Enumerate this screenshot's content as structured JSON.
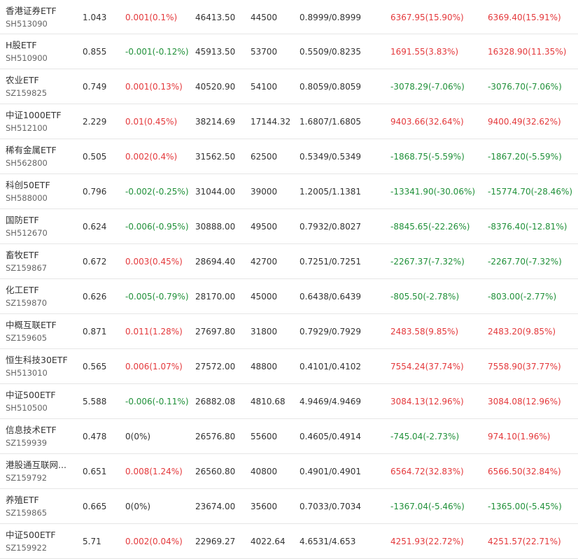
{
  "colors": {
    "up": "#e4393c",
    "down": "#21913a",
    "flat": "#333333"
  },
  "rows": [
    {
      "name": "香港证券ETF",
      "code": "SH513090",
      "price": "1.043",
      "change": "0.001(0.1%)",
      "change_dir": "up",
      "c3": "46413.50",
      "c4": "44500",
      "c5": "0.8999/0.8999",
      "c6": "6367.95(15.90%)",
      "c6_dir": "up",
      "c7": "6369.40(15.91%)",
      "c7_dir": "up"
    },
    {
      "name": "H股ETF",
      "code": "SH510900",
      "price": "0.855",
      "change": "-0.001(-0.12%)",
      "change_dir": "down",
      "c3": "45913.50",
      "c4": "53700",
      "c5": "0.5509/0.8235",
      "c6": "1691.55(3.83%)",
      "c6_dir": "up",
      "c7": "16328.90(11.35%)",
      "c7_dir": "up"
    },
    {
      "name": "农业ETF",
      "code": "SZ159825",
      "price": "0.749",
      "change": "0.001(0.13%)",
      "change_dir": "up",
      "c3": "40520.90",
      "c4": "54100",
      "c5": "0.8059/0.8059",
      "c6": "-3078.29(-7.06%)",
      "c6_dir": "down",
      "c7": "-3076.70(-7.06%)",
      "c7_dir": "down"
    },
    {
      "name": "中证1000ETF",
      "code": "SH512100",
      "price": "2.229",
      "change": "0.01(0.45%)",
      "change_dir": "up",
      "c3": "38214.69",
      "c4": "17144.32",
      "c5": "1.6807/1.6805",
      "c6": "9403.66(32.64%)",
      "c6_dir": "up",
      "c7": "9400.49(32.62%)",
      "c7_dir": "up"
    },
    {
      "name": "稀有金属ETF",
      "code": "SH562800",
      "price": "0.505",
      "change": "0.002(0.4%)",
      "change_dir": "up",
      "c3": "31562.50",
      "c4": "62500",
      "c5": "0.5349/0.5349",
      "c6": "-1868.75(-5.59%)",
      "c6_dir": "down",
      "c7": "-1867.20(-5.59%)",
      "c7_dir": "down"
    },
    {
      "name": "科创50ETF",
      "code": "SH588000",
      "price": "0.796",
      "change": "-0.002(-0.25%)",
      "change_dir": "down",
      "c3": "31044.00",
      "c4": "39000",
      "c5": "1.2005/1.1381",
      "c6": "-13341.90(-30.06%)",
      "c6_dir": "down",
      "c7": "-15774.70(-28.46%)",
      "c7_dir": "down"
    },
    {
      "name": "国防ETF",
      "code": "SH512670",
      "price": "0.624",
      "change": "-0.006(-0.95%)",
      "change_dir": "down",
      "c3": "30888.00",
      "c4": "49500",
      "c5": "0.7932/0.8027",
      "c6": "-8845.65(-22.26%)",
      "c6_dir": "down",
      "c7": "-8376.40(-12.81%)",
      "c7_dir": "down"
    },
    {
      "name": "畜牧ETF",
      "code": "SZ159867",
      "price": "0.672",
      "change": "0.003(0.45%)",
      "change_dir": "up",
      "c3": "28694.40",
      "c4": "42700",
      "c5": "0.7251/0.7251",
      "c6": "-2267.37(-7.32%)",
      "c6_dir": "down",
      "c7": "-2267.70(-7.32%)",
      "c7_dir": "down"
    },
    {
      "name": "化工ETF",
      "code": "SZ159870",
      "price": "0.626",
      "change": "-0.005(-0.79%)",
      "change_dir": "down",
      "c3": "28170.00",
      "c4": "45000",
      "c5": "0.6438/0.6439",
      "c6": "-805.50(-2.78%)",
      "c6_dir": "down",
      "c7": "-803.00(-2.77%)",
      "c7_dir": "down"
    },
    {
      "name": "中概互联ETF",
      "code": "SZ159605",
      "price": "0.871",
      "change": "0.011(1.28%)",
      "change_dir": "up",
      "c3": "27697.80",
      "c4": "31800",
      "c5": "0.7929/0.7929",
      "c6": "2483.58(9.85%)",
      "c6_dir": "up",
      "c7": "2483.20(9.85%)",
      "c7_dir": "up"
    },
    {
      "name": "恒生科技30ETF",
      "code": "SH513010",
      "price": "0.565",
      "change": "0.006(1.07%)",
      "change_dir": "up",
      "c3": "27572.00",
      "c4": "48800",
      "c5": "0.4101/0.4102",
      "c6": "7554.24(37.74%)",
      "c6_dir": "up",
      "c7": "7558.90(37.77%)",
      "c7_dir": "up"
    },
    {
      "name": "中证500ETF",
      "code": "SH510500",
      "price": "5.588",
      "change": "-0.006(-0.11%)",
      "change_dir": "down",
      "c3": "26882.08",
      "c4": "4810.68",
      "c5": "4.9469/4.9469",
      "c6": "3084.13(12.96%)",
      "c6_dir": "up",
      "c7": "3084.08(12.96%)",
      "c7_dir": "up"
    },
    {
      "name": "信息技术ETF",
      "code": "SZ159939",
      "price": "0.478",
      "change": "0(0%)",
      "change_dir": "flat",
      "c3": "26576.80",
      "c4": "55600",
      "c5": "0.4605/0.4914",
      "c6": "-745.04(-2.73%)",
      "c6_dir": "down",
      "c7": "974.10(1.96%)",
      "c7_dir": "up"
    },
    {
      "name": "港股通互联网...",
      "code": "SZ159792",
      "price": "0.651",
      "change": "0.008(1.24%)",
      "change_dir": "up",
      "c3": "26560.80",
      "c4": "40800",
      "c5": "0.4901/0.4901",
      "c6": "6564.72(32.83%)",
      "c6_dir": "up",
      "c7": "6566.50(32.84%)",
      "c7_dir": "up"
    },
    {
      "name": "养殖ETF",
      "code": "SZ159865",
      "price": "0.665",
      "change": "0(0%)",
      "change_dir": "flat",
      "c3": "23674.00",
      "c4": "35600",
      "c5": "0.7033/0.7034",
      "c6": "-1367.04(-5.46%)",
      "c6_dir": "down",
      "c7": "-1365.00(-5.45%)",
      "c7_dir": "down"
    },
    {
      "name": "中证500ETF",
      "code": "SZ159922",
      "price": "5.71",
      "change": "0.002(0.04%)",
      "change_dir": "up",
      "c3": "22969.27",
      "c4": "4022.64",
      "c5": "4.6531/4.653",
      "c6": "4251.93(22.72%)",
      "c6_dir": "up",
      "c7": "4251.57(22.71%)",
      "c7_dir": "up"
    }
  ]
}
